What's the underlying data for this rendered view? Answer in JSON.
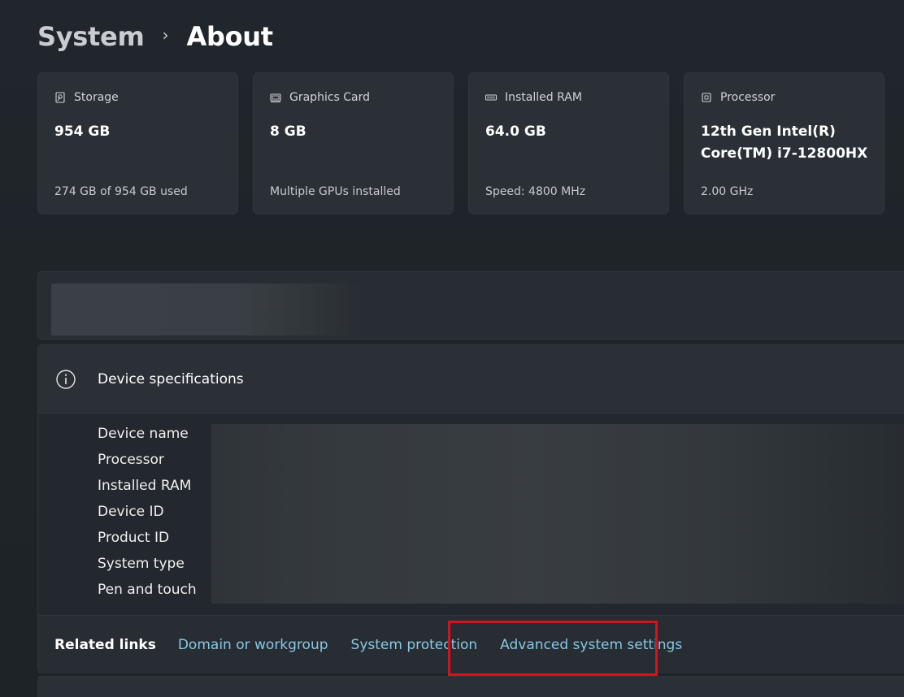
{
  "breadcrumb": {
    "parent": "System",
    "separator": "›",
    "current": "About"
  },
  "cards": [
    {
      "icon": "storage-icon",
      "title": "Storage",
      "value": "954 GB",
      "sub": "274 GB of 954 GB used"
    },
    {
      "icon": "graphics-card-icon",
      "title": "Graphics Card",
      "value": "8 GB",
      "sub": "Multiple GPUs installed"
    },
    {
      "icon": "ram-icon",
      "title": "Installed RAM",
      "value": "64.0 GB",
      "sub": "Speed: 4800 MHz"
    },
    {
      "icon": "processor-icon",
      "title": "Processor",
      "value": "12th Gen Intel(R) Core(TM) i7-12800HX",
      "sub": "2.00 GHz"
    }
  ],
  "device_specs": {
    "title": "Device specifications",
    "labels": [
      "Device name",
      "Processor",
      "Installed RAM",
      "Device ID",
      "Product ID",
      "System type",
      "Pen and touch"
    ]
  },
  "related_links": {
    "label": "Related links",
    "links": [
      "Domain or workgroup",
      "System protection",
      "Advanced system settings"
    ]
  },
  "colors": {
    "accent_link": "#86c8e6",
    "highlight": "#d9111c"
  }
}
